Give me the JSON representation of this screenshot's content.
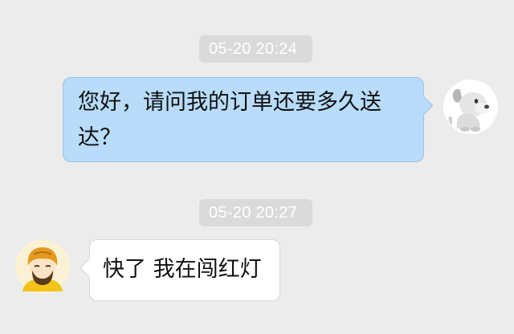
{
  "conversation": {
    "messages": [
      {
        "sender": "self",
        "timestamp": "05-20 20:24",
        "text": "您好，请问我的订单还要多久送达？"
      },
      {
        "sender": "courier",
        "timestamp": "05-20 20:27",
        "text": "快了 我在闯红灯"
      }
    ]
  },
  "icons": {
    "self_avatar": "dog-avatar-icon",
    "courier_avatar": "delivery-courier-avatar-icon"
  },
  "colors": {
    "background": "#ececec",
    "timestamp_bg": "#dadada",
    "outgoing_bubble": "#b8dcf9",
    "incoming_bubble": "#ffffff",
    "courier_helmet": "#e49a1f"
  }
}
